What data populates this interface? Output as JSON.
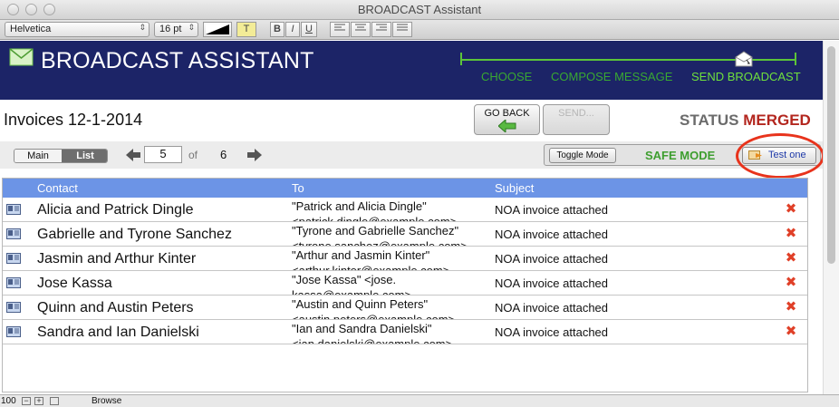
{
  "window": {
    "title": "BROADCAST Assistant"
  },
  "format_bar": {
    "font": "Helvetica",
    "size": "16 pt",
    "text_style_buttons": [
      "T",
      "B",
      "I",
      "U"
    ]
  },
  "header": {
    "app_title": "BROADCAST ASSISTANT",
    "steps": [
      {
        "label": "CHOOSE",
        "state": "done"
      },
      {
        "label": "COMPOSE MESSAGE",
        "state": "done"
      },
      {
        "label": "SEND BROADCAST",
        "state": "active"
      }
    ],
    "colors": {
      "band": "#1c2467",
      "progress": "#5cc439"
    }
  },
  "document": {
    "name": "Invoices 12-1-2014",
    "go_back_label": "GO BACK",
    "send_label": "SEND...",
    "status_label": "STATUS",
    "status_value": "MERGED"
  },
  "nav": {
    "main_label": "Main",
    "list_label": "List",
    "current_record": "5",
    "of_label": "of",
    "total_records": "6",
    "toggle_mode_label": "Toggle Mode",
    "safe_mode_label": "SAFE MODE",
    "test_one_label": "Test one"
  },
  "table": {
    "columns": [
      "Contact",
      "To",
      "Subject"
    ],
    "rows": [
      {
        "contact": "Alicia and Patrick Dingle",
        "to_line1": "\"Patrick and Alicia Dingle\"",
        "to_line2": "<patrick.dingle@example.com>",
        "subject": "NOA invoice attached"
      },
      {
        "contact": "Gabrielle and Tyrone Sanchez",
        "to_line1": "\"Tyrone and Gabrielle Sanchez\"",
        "to_line2": "<tyrone.sanchez@example.com>",
        "subject": "NOA invoice attached"
      },
      {
        "contact": "Jasmin and Arthur Kinter",
        "to_line1": "\"Arthur and Jasmin Kinter\"",
        "to_line2": "<arthur.kinter@example.com>",
        "subject": "NOA invoice attached"
      },
      {
        "contact": "Jose Kassa",
        "to_line1": "\"Jose Kassa\" <jose.",
        "to_line2": "kassa@example.com>",
        "subject": "NOA invoice attached"
      },
      {
        "contact": "Quinn and Austin Peters",
        "to_line1": "\"Austin and Quinn Peters\"",
        "to_line2": "<austin.peters@example.com>",
        "subject": "NOA invoice attached"
      },
      {
        "contact": "Sandra and Ian Danielski",
        "to_line1": "\"Ian and Sandra Danielski\"",
        "to_line2": "<ian.danielski@example.com>",
        "subject": "NOA invoice attached"
      }
    ]
  },
  "status_bar": {
    "zoom": "100",
    "mode": "Browse"
  }
}
